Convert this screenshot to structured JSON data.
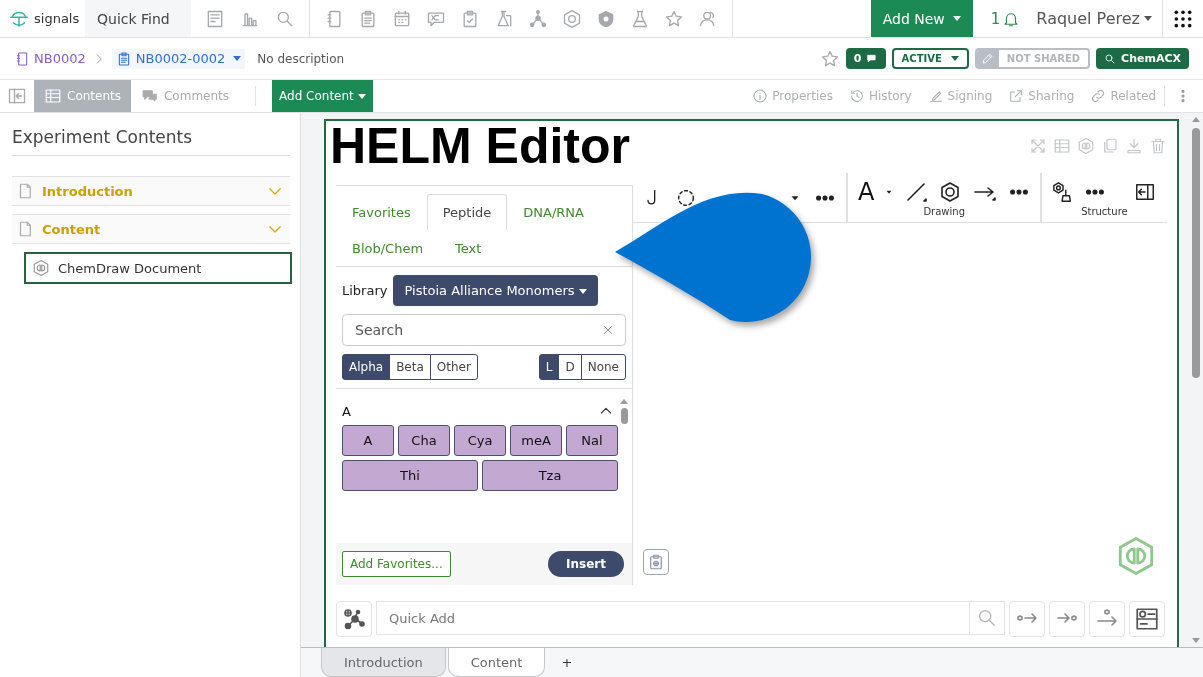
{
  "header": {
    "brand": "signals",
    "quick_find": "Quick Find",
    "add_new": "Add New",
    "notifications": "1",
    "user_name": "Raquel Perez"
  },
  "breadcrumb": {
    "items": [
      {
        "label": "NB0002",
        "kind": "notebook"
      },
      {
        "label": "NB0002-0002",
        "kind": "experiment"
      }
    ],
    "description": "No description",
    "comment_count": "0",
    "status": "ACTIVE",
    "sharing": "NOT SHARED",
    "chemacx": "ChemACX"
  },
  "view_tabs": [
    {
      "label": "Contents",
      "selected": true
    },
    {
      "label": "Comments",
      "selected": false
    }
  ],
  "add_content": "Add Content",
  "actions": [
    "Properties",
    "History",
    "Signing",
    "Sharing",
    "Related"
  ],
  "sidebar": {
    "title": "Experiment Contents",
    "sections": [
      {
        "label": "Introduction"
      },
      {
        "label": "Content",
        "children": [
          {
            "label": "ChemDraw Document",
            "selected": true
          }
        ]
      }
    ]
  },
  "editor": {
    "title": "HELM Editor",
    "palette_tabs": [
      {
        "label": "Favorites",
        "selected": false
      },
      {
        "label": "Peptide",
        "selected": true
      },
      {
        "label": "DNA/RNA",
        "selected": false
      },
      {
        "label": "Blob/Chem",
        "selected": false
      },
      {
        "label": "Text",
        "selected": false
      }
    ],
    "library_label": "Library",
    "library": "Pistoia Alliance Monomers",
    "search_placeholder": "Search",
    "polymer_types": [
      {
        "label": "Alpha",
        "selected": true
      },
      {
        "label": "Beta",
        "selected": false
      },
      {
        "label": "Other",
        "selected": false
      }
    ],
    "chirality": [
      {
        "label": "L",
        "selected": true
      },
      {
        "label": "D",
        "selected": false
      },
      {
        "label": "None",
        "selected": false
      }
    ],
    "groups": [
      {
        "letter": "A",
        "monomers": [
          "A",
          "Cha",
          "Cya",
          "meA",
          "Nal",
          "Thi",
          "Tza"
        ]
      }
    ],
    "add_favorites": "Add Favorites...",
    "insert": "Insert",
    "text_tool": "A",
    "toolbar_groups": [
      "Drawing",
      "Structure"
    ],
    "quick_add_placeholder": "Quick Add"
  },
  "page_tabs": [
    {
      "label": "Introduction",
      "selected": false
    },
    {
      "label": "Content",
      "selected": true
    }
  ],
  "add_page": "+"
}
